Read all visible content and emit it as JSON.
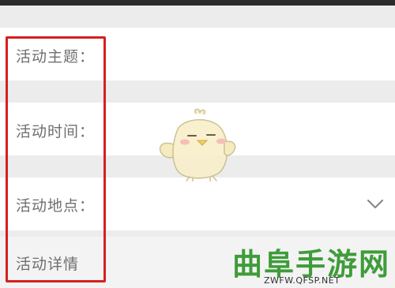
{
  "form": {
    "fields": [
      {
        "label": "活动主题："
      },
      {
        "label": "活动时间："
      },
      {
        "label": "活动地点："
      },
      {
        "label": "活动详情"
      }
    ],
    "location_dropdown_icon": "chevron-down-icon"
  },
  "watermark": {
    "title": "曲阜手游网",
    "url": "ZWFW.QFSP.NET"
  },
  "colors": {
    "highlight_border": "#d61f1f",
    "watermark_green": "#3f9c3a",
    "label_text": "#6f6f6f",
    "page_background": "#ececec"
  }
}
